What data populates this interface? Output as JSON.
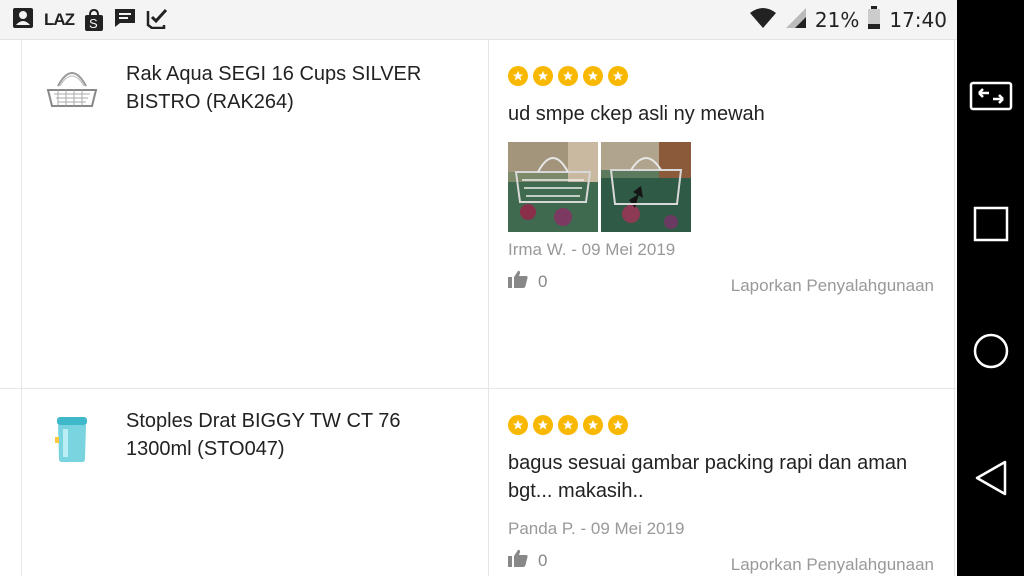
{
  "status_bar": {
    "app_icons": [
      "contact-card-icon",
      "lazada-icon",
      "shopee-bag-icon",
      "message-icon",
      "task-check-icon"
    ],
    "laz_text": "LAZ",
    "shopee_letter": "S",
    "battery_percent": "21%",
    "time": "17:40"
  },
  "navigation_bar": {
    "buttons": [
      "screen-switch-icon",
      "recents-icon",
      "home-icon",
      "back-icon"
    ]
  },
  "reviews": [
    {
      "product_name": "Rak Aqua SEGI 16 Cups SILVER BISTRO (RAK264)",
      "product_thumb": "wire-rack-icon",
      "rating": 5,
      "text": "ud smpe ckep asli ny mewah",
      "photos_count": 2,
      "meta": "Irma W. - 09 Mei 2019",
      "likes": "0",
      "report_label": "Laporkan Penyalahgunaan"
    },
    {
      "product_name": "Stoples Drat BIGGY TW CT 76 1300ml (STO047)",
      "product_thumb": "jar-icon",
      "rating": 5,
      "text": "bagus sesuai gambar packing rapi dan aman bgt... makasih..",
      "photos_count": 0,
      "meta": "Panda P. - 09 Mei 2019",
      "likes": "0",
      "report_label": "Laporkan Penyalahgunaan"
    }
  ],
  "colors": {
    "star": "#f9b800",
    "muted_text": "#999999",
    "status_bar_bg": "#f4f4f4",
    "nav_bar_bg": "#000000"
  }
}
